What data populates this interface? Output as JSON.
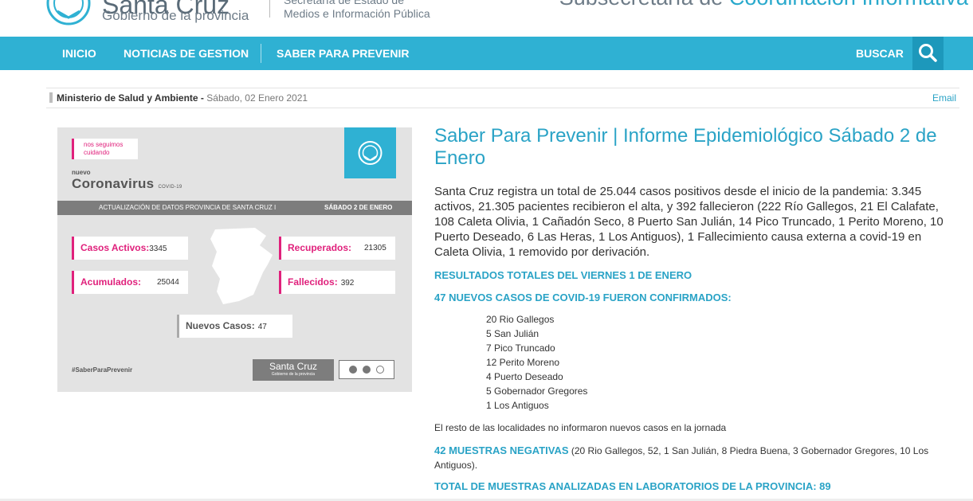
{
  "header": {
    "brand": "Santa Cruz",
    "gov": "Gobierno de la provincia",
    "secretaria_line1": "Secretaría de Estado de",
    "secretaria_line2": "Medios e Información Pública",
    "subsec_a": "Subsecretaría de",
    "subsec_b": "Coordinación Informativa"
  },
  "nav": {
    "items": [
      "INICIO",
      "NOTICIAS DE GESTION",
      "SABER PARA PREVENIR"
    ],
    "search_label": "BUSCAR",
    "color": "#2fb1d3"
  },
  "breadcrumb": {
    "ministry": "Ministerio de Salud y Ambiente -",
    "date": "Sábado, 02 Enero 2021",
    "email": "Email"
  },
  "card": {
    "tag": "nos seguimos cuidando",
    "nuevo": "nuevo",
    "coronavirus": "Coronavirus",
    "covid": "COVID-19",
    "update_left": "ACTUALIZACIÓN DE DATOS PROVINCIA DE SANTA CRUZ I",
    "update_right": "SÁBADO 2 DE ENERO",
    "activos_label": "Casos Activos:",
    "activos_value": "3345",
    "recuperados_label": "Recuperados:",
    "recuperados_value": "21305",
    "acumulados_label": "Acumulados:",
    "acumulados_value": "25044",
    "fallecidos_label": "Fallecidos:",
    "fallecidos_value": "392",
    "nuevos_label": "Nuevos Casos:",
    "nuevos_value": "47",
    "hashtag": "#SaberParaPrevenir",
    "logo_title": "Santa Cruz",
    "logo_sub": "Gobierno de la provincia"
  },
  "article": {
    "headline": "Saber Para Prevenir | Informe Epidemiológico Sábado 2 de Enero",
    "intro": "Santa Cruz registra un total de 25.044 casos positivos desde el inicio de la pandemia: 3.345 activos, 21.305 pacientes recibieron el alta, y 392 fallecieron (222 Río Gallegos, 21 El Calafate, 108 Caleta Olivia, 1 Cañadón Seco, 8 Puerto San Julián, 14 Pico Truncado, 1 Perito Moreno, 10 Puerto Deseado, 6 Las Heras, 1 Los Antiguos), 1 Fallecimiento causa externa a covid-19 en Caleta Olivia, 1 removido por derivación.",
    "results_heading": "RESULTADOS TOTALES DEL VIERNES 1 DE ENERO",
    "new_cases_heading": "47 NUEVOS CASOS DE COVID-19 FUERON CONFIRMADOS:",
    "cases": [
      "20 Rio Gallegos",
      "5 San Julián",
      "7 Pico Truncado",
      "12 Perito Moreno",
      "4 Puerto Deseado",
      "5 Gobernador Gregores",
      "1 Los Antiguos"
    ],
    "rest": "El resto de las localidades no informaron nuevos casos en la jornada",
    "negativas_bold": "42 MUESTRAS NEGATIVAS",
    "negativas_rest": " (20 Rio Gallegos, 52, 1 San Julián, 8 Piedra Buena, 3 Gobernador Gregores, 10 Los Antiguos).",
    "total_heading": "TOTAL DE MUESTRAS ANALIZADAS EN LABORATORIOS DE LA PROVINCIA: 89"
  }
}
